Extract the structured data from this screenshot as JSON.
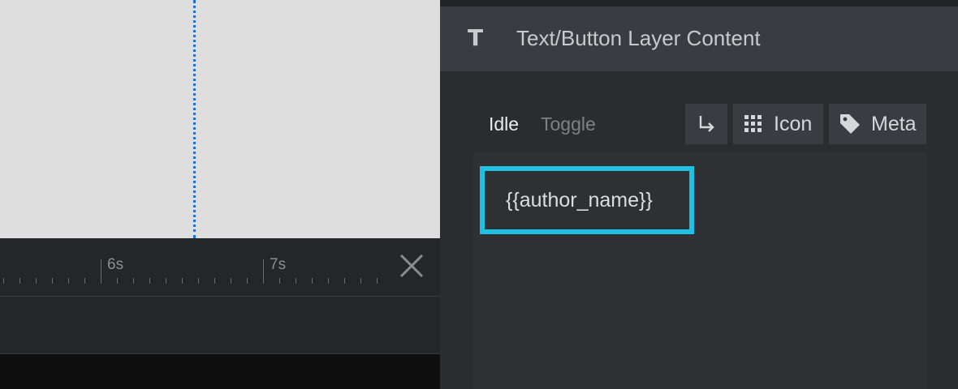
{
  "timeline": {
    "labels": [
      "6s",
      "7s"
    ],
    "close_icon": "close-icon"
  },
  "panel": {
    "header_icon": "text-type-icon",
    "title": "Text/Button Layer Content",
    "tabs": {
      "idle": "Idle",
      "toggle": "Toggle"
    },
    "buttons": {
      "link_icon": "return-arrow-icon",
      "icon_label": "Icon",
      "meta_label": "Meta"
    },
    "content_value": "{{author_name}}"
  },
  "colors": {
    "accent_frame": "#1fc0e2",
    "guide_line": "#1a73d9",
    "panel_bg": "#2b2c30",
    "header_bg": "#3b3c42"
  }
}
